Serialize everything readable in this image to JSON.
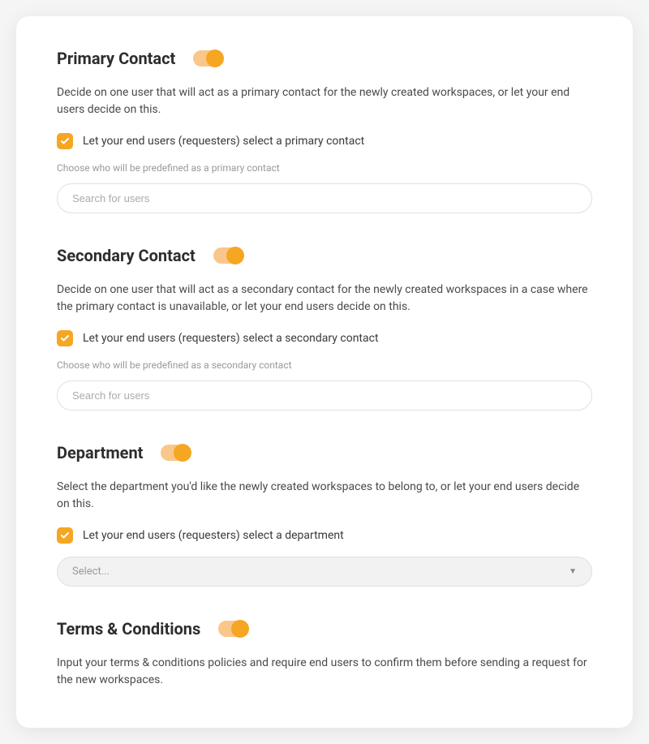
{
  "primaryContact": {
    "title": "Primary Contact",
    "description": "Decide on one user that will act as a primary contact for the newly created workspaces, or let your end users decide on this.",
    "checkboxLabel": "Let your end users (requesters) select a primary contact",
    "helperText": "Choose who will be predefined as a primary contact",
    "searchPlaceholder": "Search for users"
  },
  "secondaryContact": {
    "title": "Secondary Contact",
    "description": "Decide on one user that will act as a secondary contact for the newly created workspaces in a case where the primary contact is unavailable, or let your end users decide on this.",
    "checkboxLabel": "Let your end users (requesters) select a secondary contact",
    "helperText": "Choose who will be predefined as a secondary contact",
    "searchPlaceholder": "Search for users"
  },
  "department": {
    "title": "Department",
    "description": "Select the department you'd like the newly created workspaces to belong to, or let your end users decide on this.",
    "checkboxLabel": "Let your end users (requesters) select a department",
    "selectPlaceholder": "Select..."
  },
  "termsConditions": {
    "title": "Terms & Conditions",
    "description": "Input your terms & conditions policies and require end users to confirm them before sending a request for the new workspaces."
  }
}
